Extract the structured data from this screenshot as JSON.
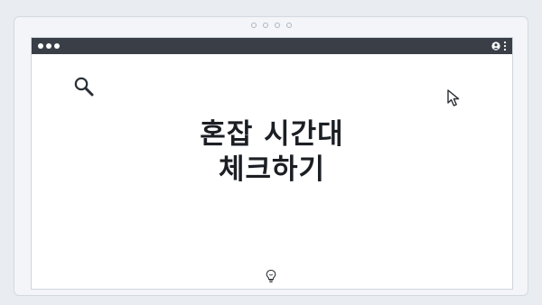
{
  "window": {
    "controls": [
      "dot",
      "dot",
      "dot"
    ],
    "right_icons": [
      "user-icon",
      "kebab-icon"
    ]
  },
  "content": {
    "title_line1": "혼잡 시간대",
    "title_line2": "체크하기",
    "icons": [
      "search-icon",
      "cursor-icon",
      "lightbulb-icon"
    ]
  },
  "colors": {
    "titlebar": "#3a3f47",
    "background": "#e9edf2",
    "text": "#1b1f24"
  }
}
